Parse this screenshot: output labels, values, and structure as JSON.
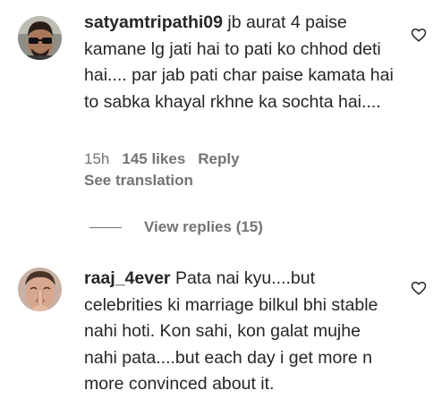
{
  "comments": [
    {
      "username": "satyamtripathi09",
      "text": "jb aurat 4 paise kamane lg jati hai to pati ko chhod deti hai.... par jab pati char paise kamata hai to sabka khayal rkhne ka sochta hai....",
      "time": "15h",
      "likes": "145 likes",
      "reply_label": "Reply",
      "translation_label": "See translation",
      "avatar_icon": "sunglasses-man-avatar",
      "heart_icon": "heart-outline-icon"
    },
    {
      "username": "raaj_4ever",
      "text": "Pata nai kyu....but celebrities ki marriage bilkul bhi stable nahi hoti. Kon sahi, kon galat mujhe nahi pata....but each day i get more n more convinced about it.",
      "avatar_icon": "shush-gesture-avatar",
      "heart_icon": "heart-outline-icon"
    }
  ],
  "view_replies": {
    "label": "View replies (15)"
  },
  "colors": {
    "text": "#262626",
    "secondary": "#737373",
    "background": "#ffffff"
  }
}
